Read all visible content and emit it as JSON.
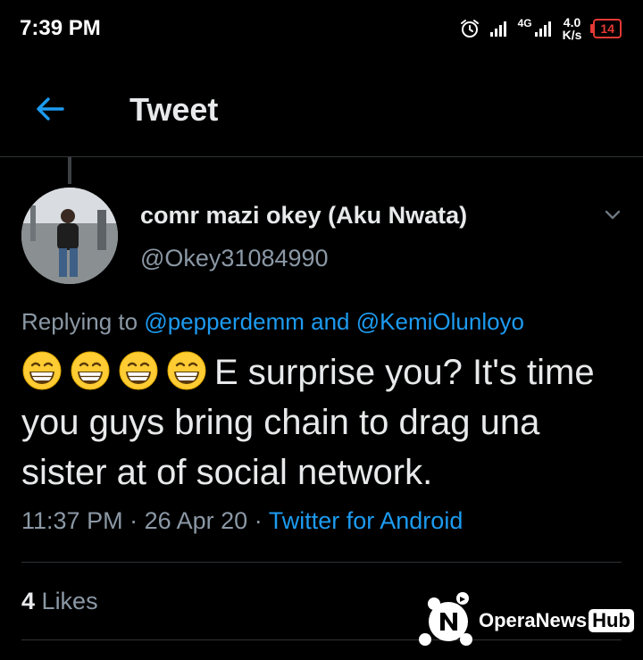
{
  "status_bar": {
    "time": "7:39 PM",
    "network": "4G",
    "speed_value": "4.0",
    "speed_unit": "K/s",
    "battery": "14",
    "battery_color": "#e53935"
  },
  "header": {
    "back_icon": "arrow-left-icon",
    "title": "Tweet",
    "accent": "#1d9bf0"
  },
  "tweet": {
    "author_name": "comr mazi okey (Aku Nwata)",
    "author_handle": "@Okey31084990",
    "replying_prefix": "Replying to",
    "reply_user_1": "@pepperdemm",
    "reply_and": "and",
    "reply_user_2": "@KemiOlunloyo",
    "emoji_count": 4,
    "emoji_name": "grinning-face-with-smiling-eyes",
    "text": "E surprise you? It's time you guys bring chain to drag una sister at of social network.",
    "time": "11:37 PM",
    "date": "26 Apr 20",
    "separator": "·",
    "source": "Twitter for Android"
  },
  "stats": {
    "likes_count": "4",
    "likes_label": "Likes"
  },
  "watermark": {
    "brand": "OperaNews",
    "hub": "Hub"
  }
}
